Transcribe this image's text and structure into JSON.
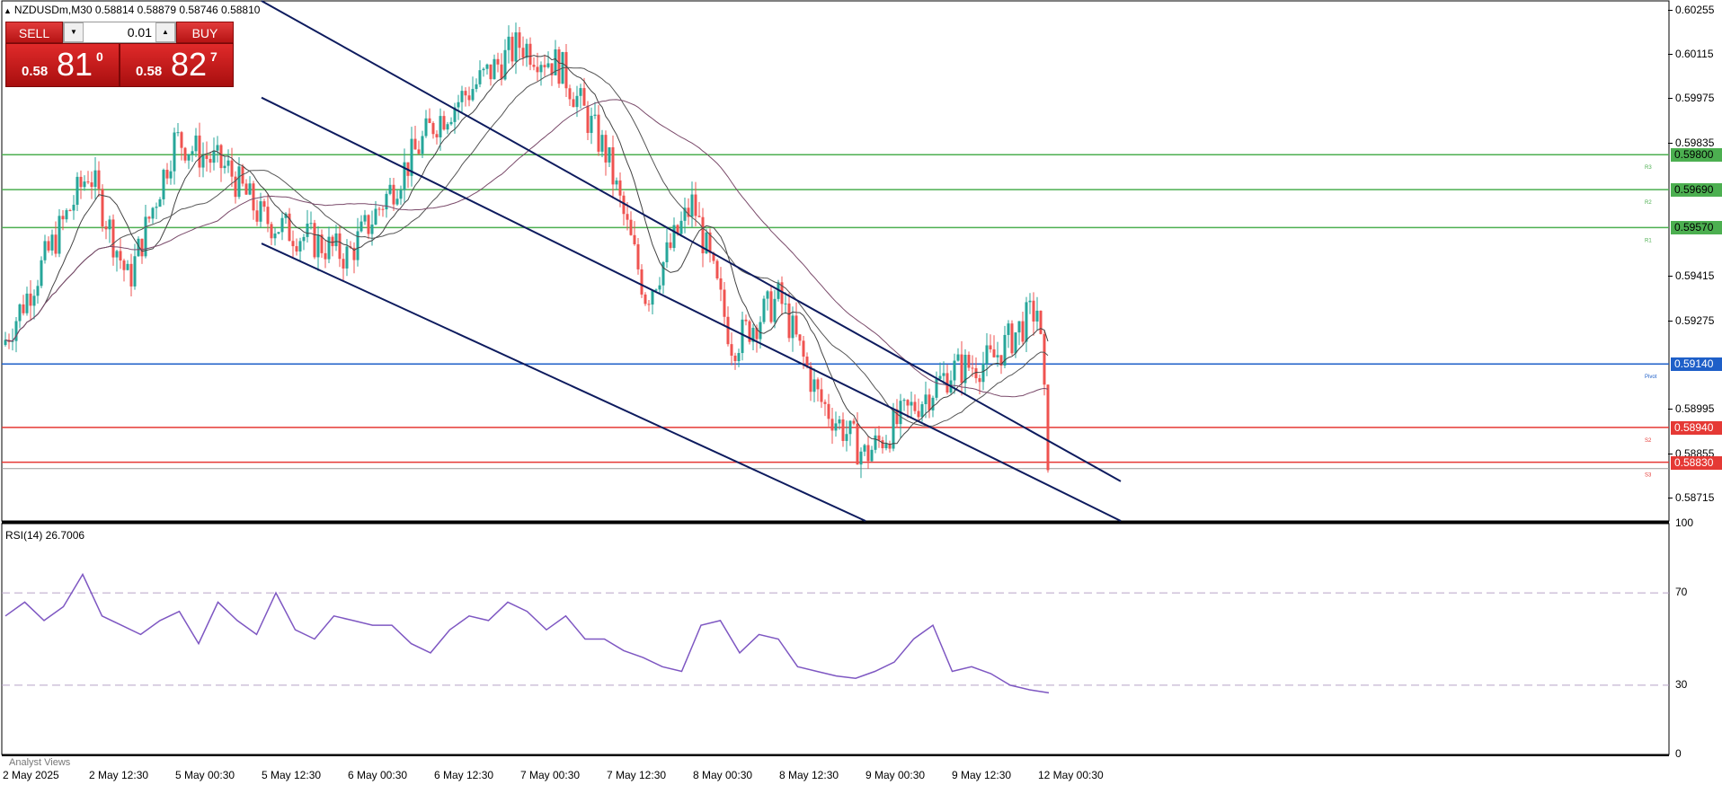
{
  "header": {
    "symbol_line": "NZDUSDm,M30  0.58814 0.58879 0.58746 0.58810",
    "rsi_line": "RSI(14) 26.7006"
  },
  "trade_panel": {
    "sell_label": "SELL",
    "buy_label": "BUY",
    "lot_value": "0.01",
    "sell_price": {
      "small": "0.58",
      "big": "81",
      "sup": "0"
    },
    "buy_price": {
      "small": "0.58",
      "big": "82",
      "sup": "7"
    }
  },
  "footer": {
    "analyst_label": "Analyst Views"
  },
  "colors": {
    "bull": "#26a69a",
    "bear": "#ef5350",
    "resistance": "#4caf50",
    "pivot": "#1e5fc8",
    "support": "#e53935",
    "channel": "#0d1b5e",
    "rsi": "#7e57c2"
  },
  "chart_data": [
    {
      "type": "candlestick",
      "title": "NZDUSDm,M30",
      "ohlc_latest": {
        "open": 0.58814,
        "high": 0.58879,
        "low": 0.58746,
        "close": 0.5881
      },
      "y_ticks": [
        "0.60255",
        "0.60115",
        "0.59975",
        "0.59835",
        "0.59415",
        "0.59275",
        "0.58995",
        "0.58855",
        "0.58715"
      ],
      "ylim": [
        0.58645,
        0.60285
      ],
      "x_ticks": [
        "2 May 2025",
        "2 May 12:30",
        "5 May 00:30",
        "5 May 12:30",
        "6 May 00:30",
        "6 May 12:30",
        "7 May 00:30",
        "7 May 12:30",
        "8 May 00:30",
        "8 May 12:30",
        "9 May 00:30",
        "9 May 12:30",
        "12 May 00:30"
      ],
      "price_path": [
        {
          "date": "2 May 2025",
          "price": 0.592
        },
        {
          "date": "2 May 12:30",
          "price": 0.5975
        },
        {
          "date": "2 May 18:00",
          "price": 0.594
        },
        {
          "date": "5 May 00:30",
          "price": 0.5985
        },
        {
          "date": "5 May 08:00",
          "price": 0.5975
        },
        {
          "date": "5 May 12:30",
          "price": 0.596
        },
        {
          "date": "6 May 00:30",
          "price": 0.5948
        },
        {
          "date": "6 May 12:30",
          "price": 0.599
        },
        {
          "date": "7 May 00:30",
          "price": 0.6015
        },
        {
          "date": "7 May 06:00",
          "price": 0.6008
        },
        {
          "date": "7 May 12:30",
          "price": 0.598
        },
        {
          "date": "7 May 18:00",
          "price": 0.5935
        },
        {
          "date": "8 May 00:30",
          "price": 0.5965
        },
        {
          "date": "8 May 06:00",
          "price": 0.592
        },
        {
          "date": "8 May 12:30",
          "price": 0.5935
        },
        {
          "date": "8 May 18:00",
          "price": 0.5903
        },
        {
          "date": "9 May 00:30",
          "price": 0.5885
        },
        {
          "date": "9 May 06:00",
          "price": 0.5898
        },
        {
          "date": "9 May 12:30",
          "price": 0.5912
        },
        {
          "date": "9 May 18:00",
          "price": 0.5915
        },
        {
          "date": "12 May 00:30",
          "price": 0.5932
        },
        {
          "date": "12 May 02:00",
          "price": 0.5881
        }
      ],
      "levels": [
        {
          "name": "R3",
          "value": "0.59800",
          "color": "#4caf50"
        },
        {
          "name": "R2",
          "value": "0.59690",
          "color": "#4caf50"
        },
        {
          "name": "R1",
          "value": "0.59570",
          "color": "#4caf50"
        },
        {
          "name": "Pivot",
          "value": "0.59140",
          "color": "#1e5fc8"
        },
        {
          "name": "S2",
          "value": "0.58940",
          "color": "#e53935"
        },
        {
          "name": "S3",
          "value": "0.58830",
          "color": "#e53935"
        }
      ],
      "bid_line": 0.5881,
      "channel_lines": [
        {
          "from": {
            "date": "5 May 12:30",
            "price": 0.60285
          },
          "to": {
            "date": "12 May 12:00",
            "price": 0.5877
          }
        },
        {
          "from": {
            "date": "5 May 12:30",
            "price": 0.5998
          },
          "to": {
            "date": "12 May 12:00",
            "price": 0.58645
          }
        },
        {
          "from": {
            "date": "5 May 12:30",
            "price": 0.5952
          },
          "to": {
            "date": "9 May 00:30",
            "price": 0.58645
          }
        }
      ]
    },
    {
      "type": "line",
      "title": "RSI(14) 26.7006",
      "ylim": [
        0,
        100
      ],
      "y_ticks": [
        "100",
        "70",
        "30",
        "0"
      ],
      "levels": [
        70,
        30
      ],
      "series": [
        {
          "name": "RSI(14)",
          "values": [
            60,
            66,
            58,
            64,
            78,
            60,
            56,
            52,
            58,
            62,
            48,
            66,
            58,
            52,
            70,
            54,
            50,
            60,
            58,
            56,
            56,
            48,
            44,
            54,
            60,
            58,
            66,
            62,
            54,
            60,
            50,
            50,
            45,
            42,
            38,
            36,
            56,
            58,
            44,
            52,
            50,
            38,
            36,
            34,
            33,
            36,
            40,
            50,
            56,
            36,
            38,
            35,
            30,
            28,
            26.7
          ]
        }
      ],
      "latest": 26.7006
    }
  ]
}
